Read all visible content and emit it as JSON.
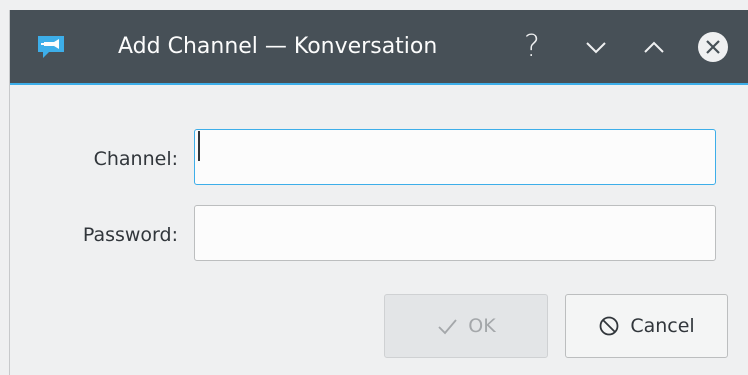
{
  "window": {
    "title": "Add Channel — Konversation",
    "help_glyph": "?"
  },
  "form": {
    "channel_label": "Channel:",
    "channel_value": "",
    "password_label": "Password:",
    "password_value": ""
  },
  "buttons": {
    "ok_label": "OK",
    "cancel_label": "Cancel"
  },
  "colors": {
    "titlebar": "#475057",
    "accent": "#3daee9",
    "background": "#eff0f1"
  }
}
